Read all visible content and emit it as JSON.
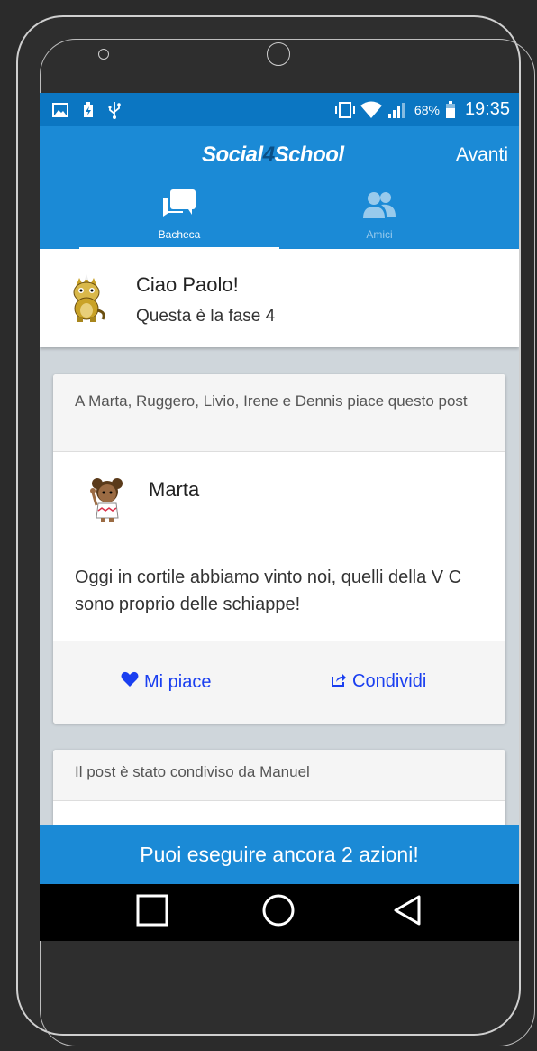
{
  "status_bar": {
    "icons_left": [
      "image-icon",
      "battery-charging-icon",
      "usb-icon"
    ],
    "icons_right": [
      "vibrate-icon",
      "wifi-icon",
      "signal-icon",
      "battery-icon"
    ],
    "battery_percent": "68%",
    "time": "19:35"
  },
  "app_bar": {
    "logo_part1": "Social",
    "logo_part2": "4",
    "logo_part3": "School",
    "next_label": "Avanti",
    "tabs": [
      {
        "label": "Bacheca",
        "icon": "chat-icon",
        "active": true
      },
      {
        "label": "Amici",
        "icon": "friends-icon",
        "active": false
      }
    ]
  },
  "greeting": {
    "name_line": "Ciao Paolo!",
    "phase_line": "Questa è la fase 4",
    "avatar": "dinosaur-avatar"
  },
  "post": {
    "likes_text": "A Marta, Ruggero, Livio, Irene e Dennis piace questo post",
    "author": "Marta",
    "author_avatar": "girl-avatar",
    "text": "Oggi in cortile abbiamo vinto noi, quelli della V C sono proprio delle schiappe!",
    "like_label": "Mi piace",
    "share_label": "Condividi"
  },
  "post2": {
    "shared_text": "Il post è stato condiviso da Manuel"
  },
  "banner": {
    "text": "Puoi eseguire ancora 2 azioni!"
  },
  "colors": {
    "status_bar": "#0b76c2",
    "app_bar": "#1b8ad6",
    "action_link": "#1a3ff0",
    "feed_background": "#cfd6db"
  }
}
